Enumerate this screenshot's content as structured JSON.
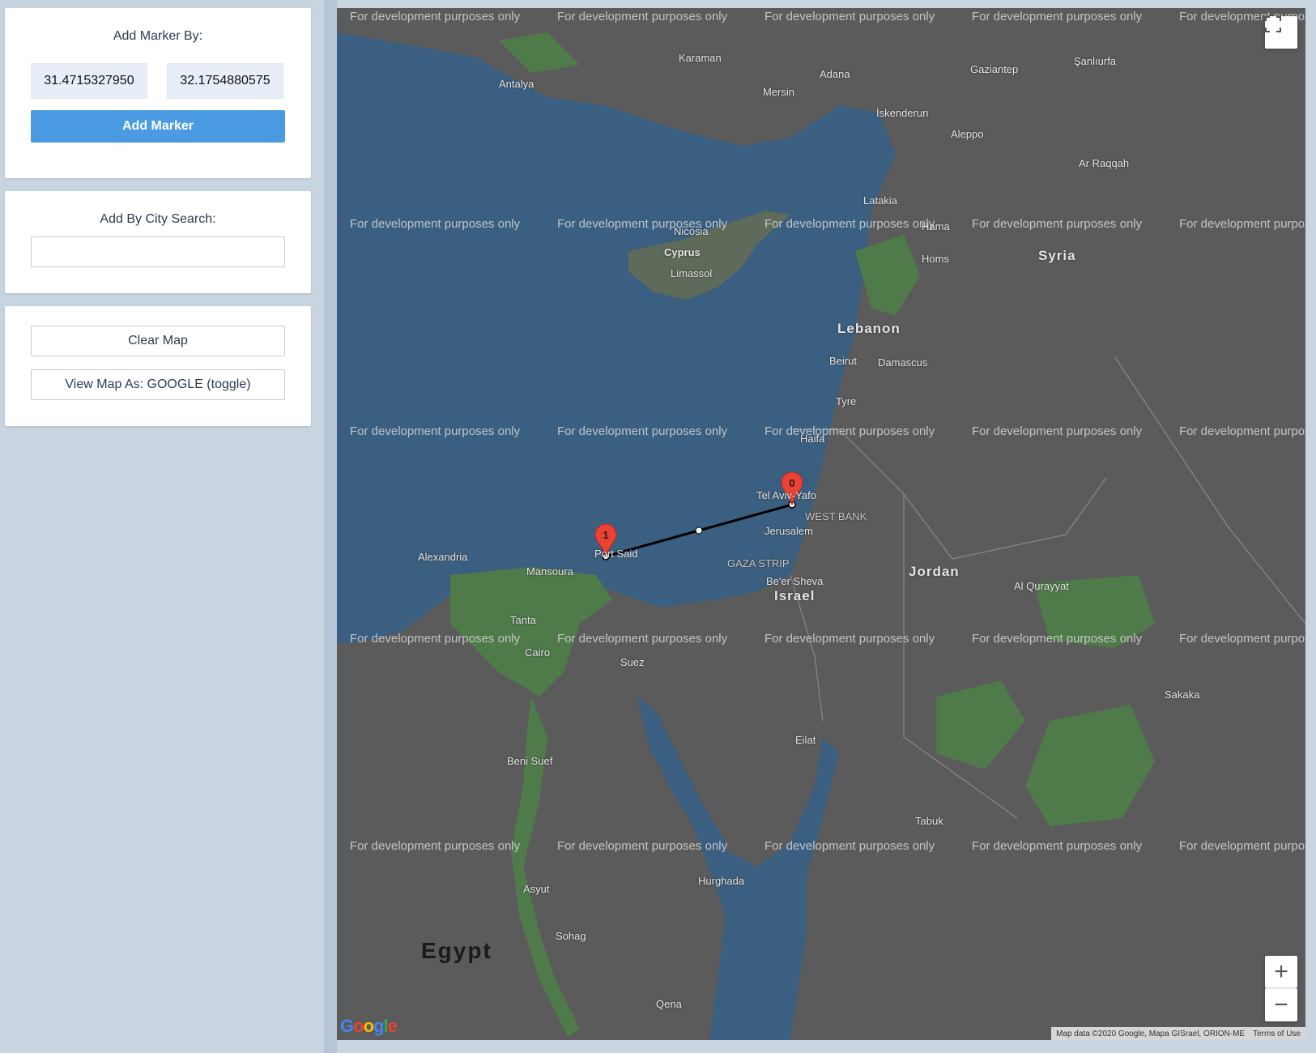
{
  "marker_panel": {
    "title": "Add Marker By:",
    "latitude_value": "31.4715327950",
    "longitude_value": "32.1754880575",
    "add_button": "Add Marker"
  },
  "search_panel": {
    "title": "Add By City Search:",
    "input_value": ""
  },
  "actions_panel": {
    "clear_button": "Clear Map",
    "view_toggle_button": "View Map As: GOOGLE (toggle)"
  },
  "map": {
    "watermark": "For development purposes only",
    "markers": [
      {
        "label": "0"
      },
      {
        "label": "1"
      }
    ],
    "place_labels": {
      "syria": "Syria",
      "lebanon": "Lebanon",
      "jordan": "Jordan",
      "israel": "Israel",
      "egypt": "Egypt",
      "cyprus": "Cyprus",
      "west_bank": "WEST BANK",
      "gaza_strip": "GAZA STRIP",
      "tel_aviv": "Tel Aviv-Yafo",
      "jerusalem": "Jerusalem",
      "port_said": "Port Said",
      "alexandria": "Alexandria",
      "cairo": "Cairo",
      "mansoura": "Mansoura",
      "tanta": "Tanta",
      "suez": "Suez",
      "beni_suef": "Beni Suef",
      "asyut": "Asyut",
      "sohag": "Sohag",
      "hurghada": "Hurghada",
      "beirut": "Beirut",
      "damascus": "Damascus",
      "homs": "Homs",
      "hama": "Hama",
      "haifa": "Haifa",
      "aleppo": "Aleppo",
      "adana": "Adana",
      "mersin": "Mersin",
      "antalya": "Antalya",
      "gaziantep": "Gaziantep",
      "latakia": "Latakia",
      "nicosia": "Nicosia",
      "limassol": "Limassol",
      "beer_sheva": "Be'er Sheva",
      "eilat": "Eilat",
      "tabuk": "Tabuk",
      "sakaka": "Sakaka",
      "al_qurayyat": "Al Qurayyat",
      "tyre": "Tyre",
      "karaman": "Karaman",
      "sanliurfa": "Şanlıurfa",
      "iskenderun": "İskenderun",
      "ar_raqqah": "Ar Raqqah",
      "qena": "Qena"
    },
    "zoom_in": "+",
    "zoom_out": "−",
    "fullscreen_icon": "fullscreen-icon",
    "attribution": "Map data ©2020 Google, Mapa GISrael, ORION-ME",
    "terms": "Terms of Use",
    "logo": "Google"
  },
  "colors": {
    "primary": "#4a9be2",
    "sea": "#3b5f80",
    "land": "#5b5b5b",
    "green_areas": "#4f7a4a",
    "marker": "#ea4335"
  }
}
